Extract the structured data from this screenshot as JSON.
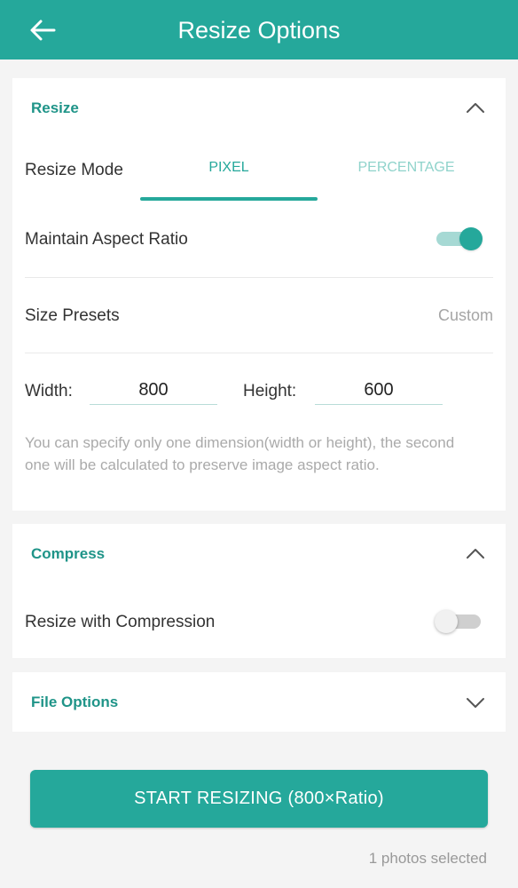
{
  "appbar": {
    "title": "Resize Options",
    "back_icon": "arrow-left-icon"
  },
  "resize_section": {
    "title": "Resize",
    "expanded": true,
    "resize_mode_label": "Resize Mode",
    "tabs": [
      {
        "label": "PIXEL",
        "selected": true
      },
      {
        "label": "PERCENTAGE",
        "selected": false
      }
    ],
    "aspect_label": "Maintain Aspect Ratio",
    "aspect_on": true,
    "presets_label": "Size Presets",
    "presets_value": "Custom",
    "width_label": "Width:",
    "width_value": "800",
    "height_label": "Height:",
    "height_value": "600",
    "hint": "You can specify only one dimension(width or height), the second one will be calculated to preserve image aspect ratio."
  },
  "compress_section": {
    "title": "Compress",
    "expanded": true,
    "compression_label": "Resize with Compression",
    "compression_on": false
  },
  "file_options_section": {
    "title": "File Options",
    "expanded": false
  },
  "start_button": "START RESIZING (800×Ratio)",
  "status": "1 photos selected",
  "colors": {
    "accent": "#25a89b",
    "section_title": "#1f9488",
    "tab_inactive": "#8fd3cb",
    "background": "#f4f4f4"
  }
}
